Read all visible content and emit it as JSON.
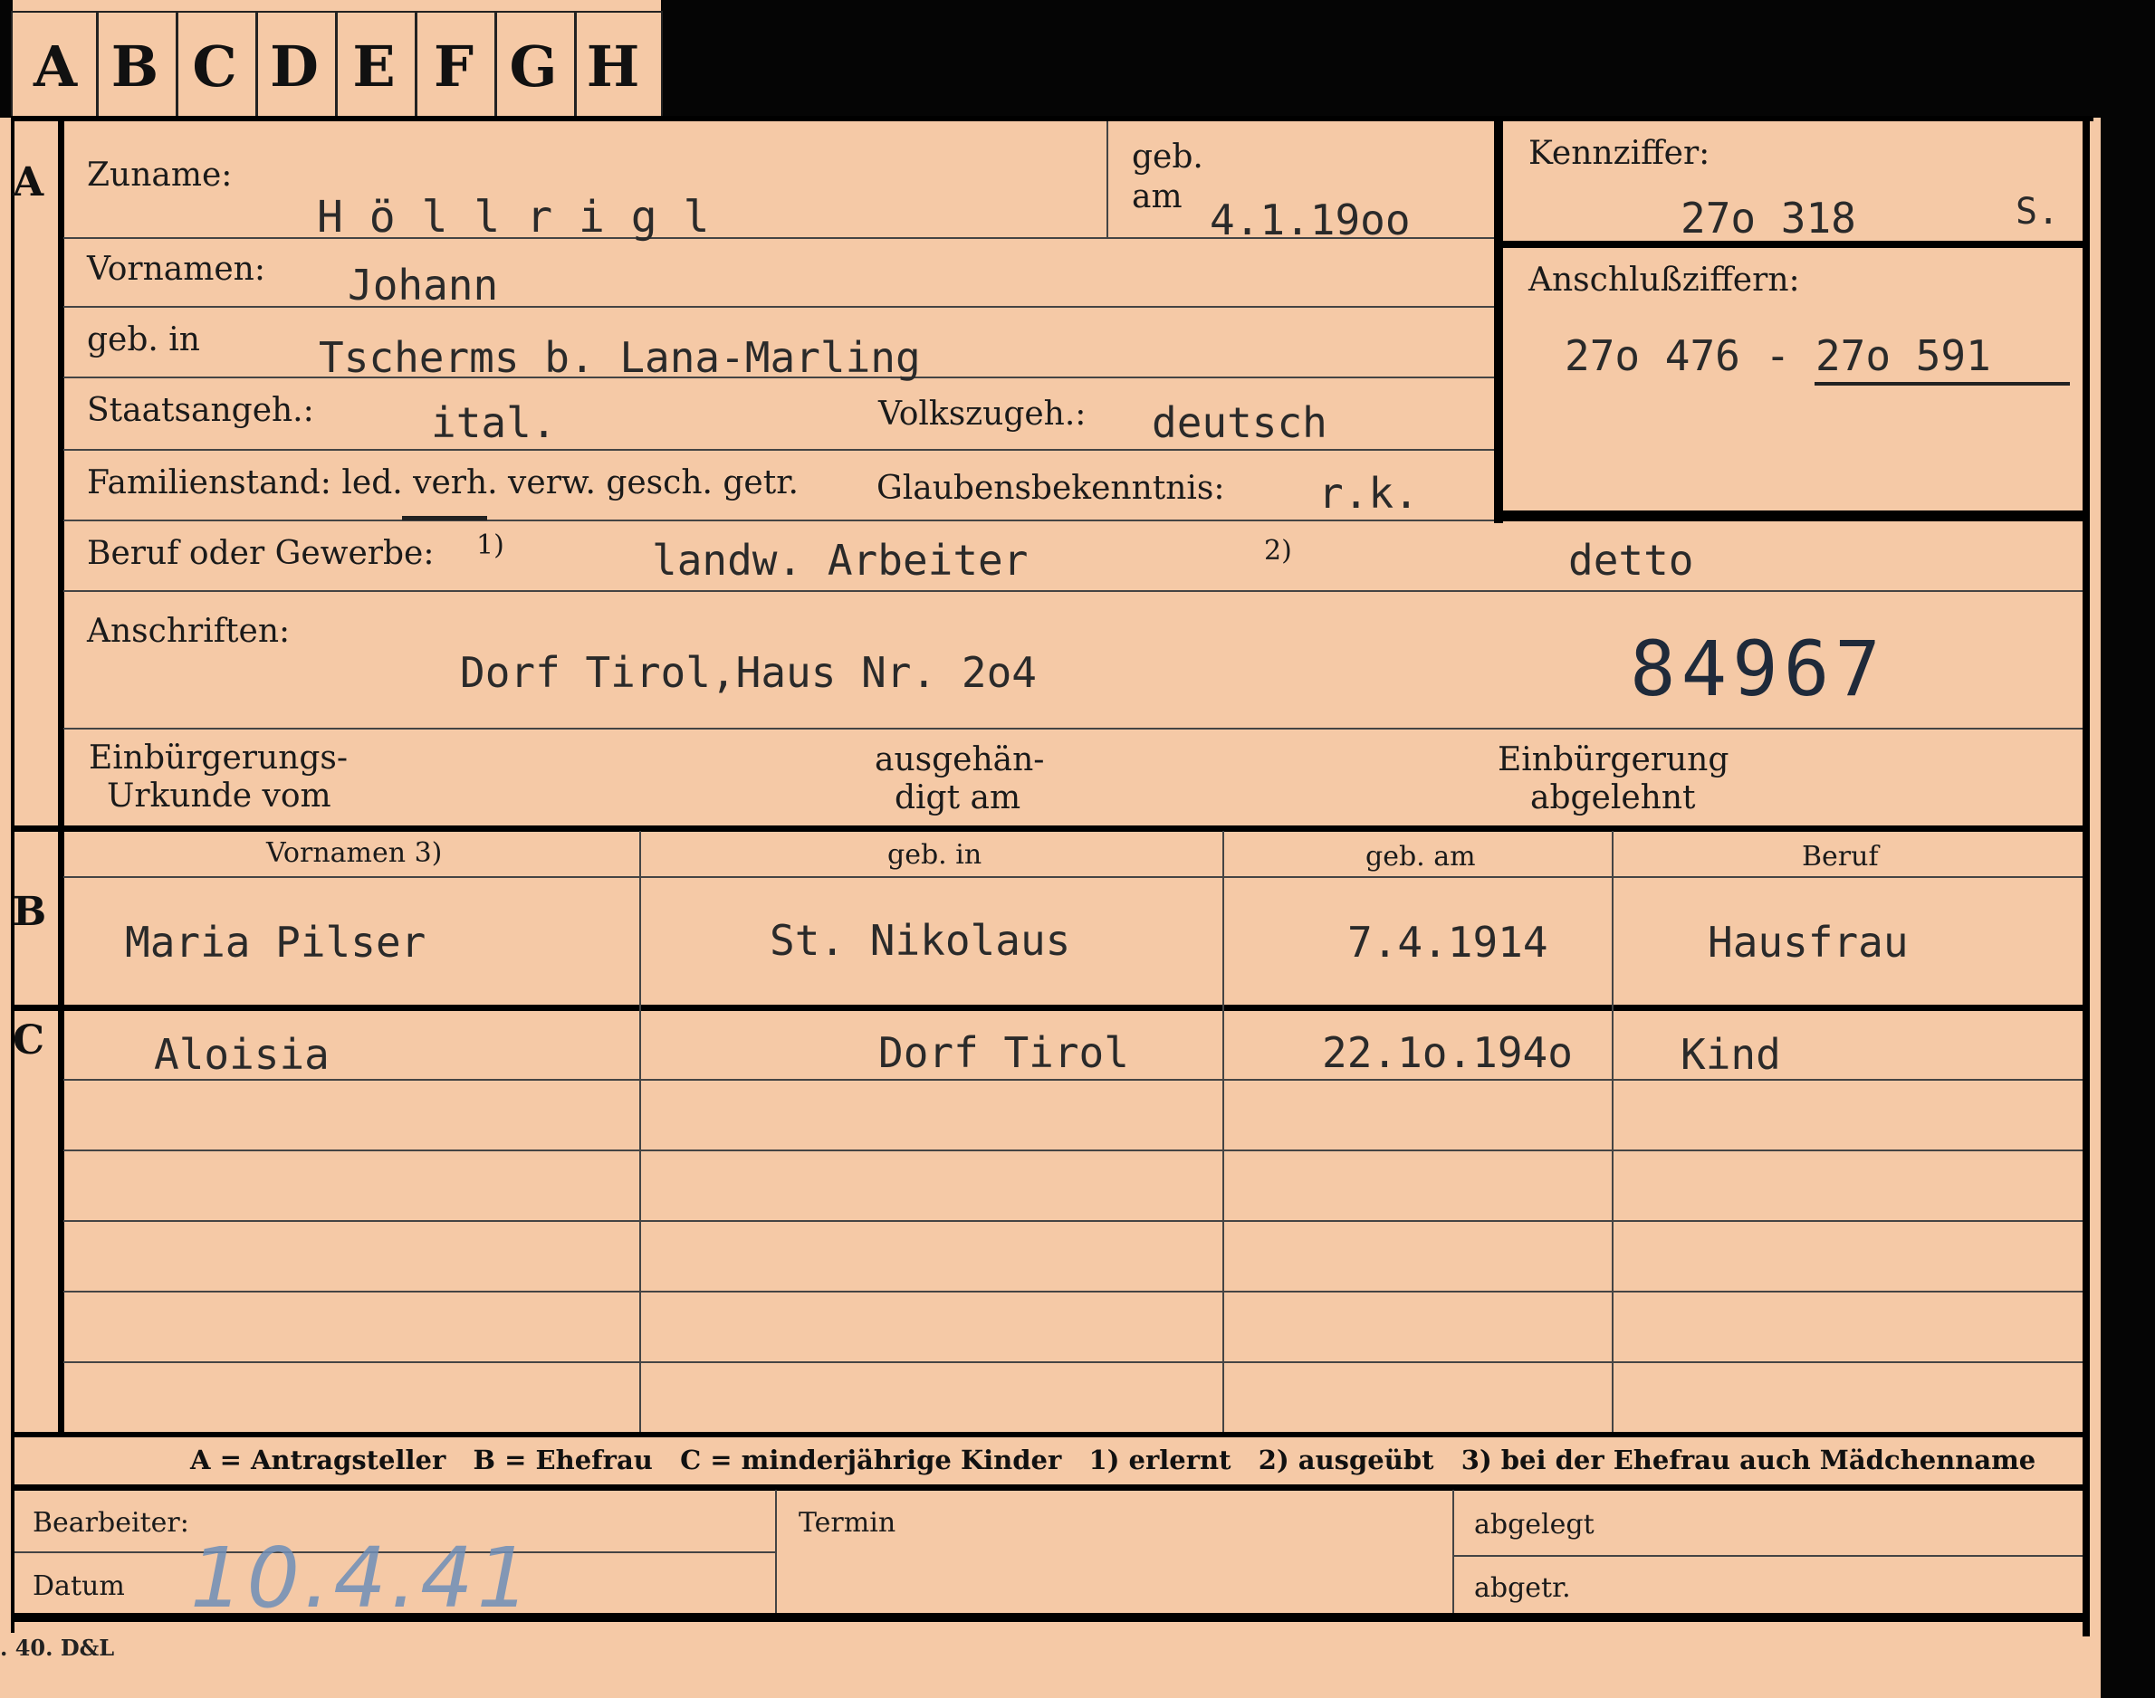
{
  "tabs": [
    "A",
    "B",
    "C",
    "D",
    "E",
    "F",
    "G",
    "H"
  ],
  "section_letters": {
    "a": "A",
    "b": "B",
    "c": "C"
  },
  "applicant": {
    "zuname_label": "Zuname:",
    "zuname_value": "H ö l l r i g l",
    "geb_label_1": "geb.",
    "geb_label_2": "am",
    "geb_am_value": "4.1.19oo",
    "vornamen_label": "Vornamen:",
    "vornamen_value": "Johann",
    "geb_in_label": "geb. in",
    "geb_in_value": "Tscherms b. Lana-Marling",
    "staatsangeh_label": "Staatsangeh.:",
    "staatsangeh_value": "ital.",
    "volkszugeh_label": "Volkszugeh.:",
    "volkszugeh_value": "deutsch",
    "familienstand_label": "Familienstand: led. verh. verw. gesch. getr.",
    "glaubens_label": "Glaubensbekenntnis:",
    "glaubens_value": "r.k.",
    "beruf_label": "Beruf oder Gewerbe:",
    "beruf_note1": "1)",
    "beruf_value1": "landw. Arbeiter",
    "beruf_note2": "2)",
    "beruf_value2": "detto",
    "anschriften_label": "Anschriften:",
    "anschriften_value": "Dorf Tirol,Haus Nr. 2o4",
    "stamp_number": "84967",
    "einb_urkunde_label_1": "Einbürgerungs-",
    "einb_urkunde_label_2": "Urkunde vom",
    "ausgehaen_label_1": "ausgehän-",
    "ausgehaen_label_2": "digt am",
    "einb_abgelehnt_label_1": "Einbürgerung",
    "einb_abgelehnt_label_2": "abgelehnt"
  },
  "kennziffer": {
    "label": "Kennziffer:",
    "value": "27o 318",
    "suffix": "S.",
    "anschluss_label": "Anschlußziffern:",
    "anschluss_value": "27o 476 - 27o 591"
  },
  "table": {
    "headers": [
      "Vornamen 3)",
      "geb. in",
      "geb. am",
      "Beruf"
    ],
    "spouse": {
      "vornamen": "Maria  Pilser",
      "geb_in": "St. Nikolaus",
      "geb_am": "7.4.1914",
      "beruf": "Hausfrau"
    },
    "children": [
      {
        "vornamen": "Aloisia",
        "geb_in": "Dorf Tirol",
        "geb_am": "22.1o.194o",
        "beruf": "Kind"
      }
    ]
  },
  "legend": "A = Antragsteller   B = Ehefrau   C = minderjährige Kinder   1) erlernt   2) ausgeübt   3) bei der Ehefrau auch Mädchenname",
  "footer": {
    "bearbeiter_label": "Bearbeiter:",
    "datum_label": "Datum",
    "datum_value": "10.4.41",
    "termin_label": "Termin",
    "abgelegt_label": "abgelegt",
    "abgetr_label": "abgetr."
  },
  "printer_mark": ". 40. D&L"
}
